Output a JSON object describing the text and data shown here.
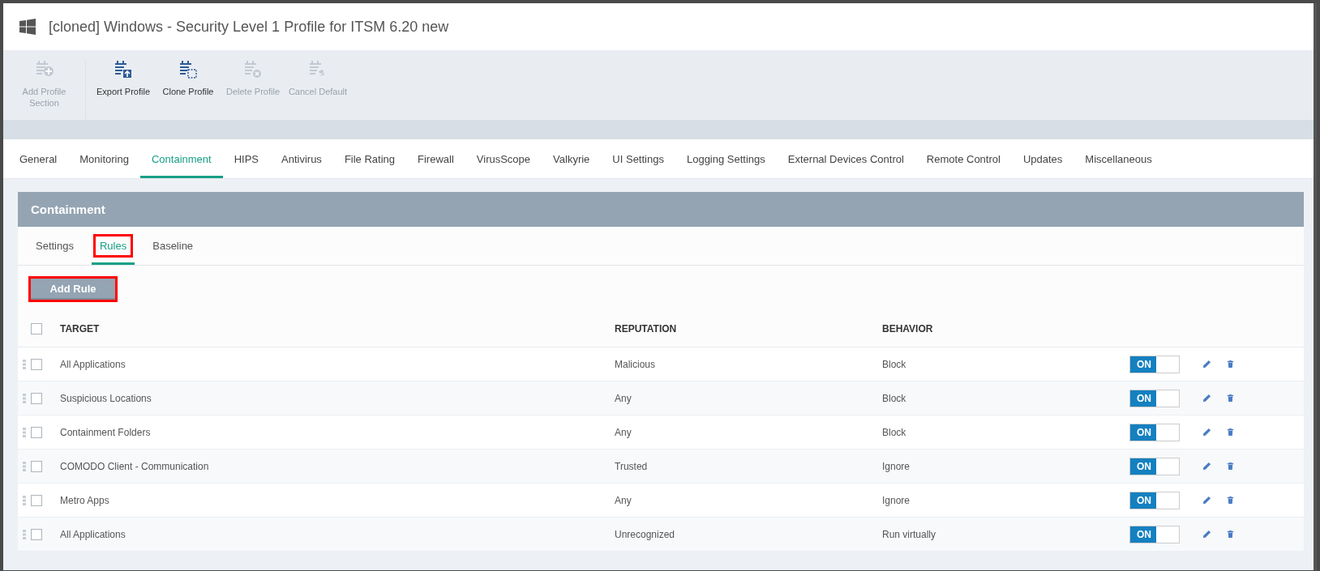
{
  "window": {
    "title": "[cloned] Windows - Security Level 1 Profile for ITSM 6.20 new"
  },
  "toolbar": [
    {
      "label": "Add Profile Section",
      "kind": "add",
      "disabled": true
    },
    {
      "label": "Export Profile",
      "kind": "export",
      "disabled": false
    },
    {
      "label": "Clone Profile",
      "kind": "clone",
      "disabled": false
    },
    {
      "label": "Delete Profile",
      "kind": "delete",
      "disabled": true
    },
    {
      "label": "Cancel Default",
      "kind": "cancel",
      "disabled": true
    }
  ],
  "tabs": [
    {
      "label": "General",
      "selected": false
    },
    {
      "label": "Monitoring",
      "selected": false
    },
    {
      "label": "Containment",
      "selected": true
    },
    {
      "label": "HIPS",
      "selected": false
    },
    {
      "label": "Antivirus",
      "selected": false
    },
    {
      "label": "File Rating",
      "selected": false
    },
    {
      "label": "Firewall",
      "selected": false
    },
    {
      "label": "VirusScope",
      "selected": false
    },
    {
      "label": "Valkyrie",
      "selected": false
    },
    {
      "label": "UI Settings",
      "selected": false
    },
    {
      "label": "Logging Settings",
      "selected": false
    },
    {
      "label": "External Devices Control",
      "selected": false
    },
    {
      "label": "Remote Control",
      "selected": false
    },
    {
      "label": "Updates",
      "selected": false
    },
    {
      "label": "Miscellaneous",
      "selected": false
    }
  ],
  "panel": {
    "title": "Containment",
    "subtabs": [
      {
        "label": "Settings",
        "selected": false,
        "highlighted": false
      },
      {
        "label": "Rules",
        "selected": true,
        "highlighted": true
      },
      {
        "label": "Baseline",
        "selected": false,
        "highlighted": false
      }
    ],
    "add_button": {
      "label": "Add Rule",
      "highlighted": true
    },
    "table": {
      "select_all": false,
      "columns": [
        "TARGET",
        "REPUTATION",
        "BEHAVIOR"
      ],
      "rows": [
        {
          "checked": false,
          "target": "All Applications",
          "reputation": "Malicious",
          "behavior": "Block",
          "toggle": "ON",
          "on": true
        },
        {
          "checked": false,
          "target": "Suspicious Locations",
          "reputation": "Any",
          "behavior": "Block",
          "toggle": "ON",
          "on": true
        },
        {
          "checked": false,
          "target": "Containment Folders",
          "reputation": "Any",
          "behavior": "Block",
          "toggle": "ON",
          "on": true
        },
        {
          "checked": false,
          "target": "COMODO Client - Communication",
          "reputation": "Trusted",
          "behavior": "Ignore",
          "toggle": "ON",
          "on": true
        },
        {
          "checked": false,
          "target": "Metro Apps",
          "reputation": "Any",
          "behavior": "Ignore",
          "toggle": "ON",
          "on": true
        },
        {
          "checked": false,
          "target": "All Applications",
          "reputation": "Unrecognized",
          "behavior": "Run virtually",
          "toggle": "ON",
          "on": true
        }
      ]
    }
  }
}
